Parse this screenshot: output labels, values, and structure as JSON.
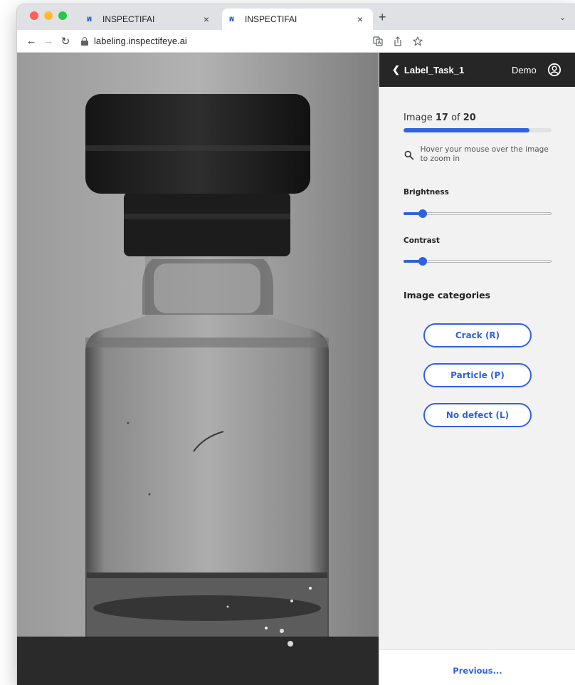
{
  "browser": {
    "tabs": [
      {
        "title": "INSPECTIFAI",
        "favicon": "inspectifai-logo-icon",
        "active": false
      },
      {
        "title": "INSPECTIFAI",
        "favicon": "inspectifai-logo-icon",
        "active": true
      }
    ],
    "tab_close_glyph": "×",
    "new_tab_glyph": "+",
    "url": "labeling.inspectifeye.ai"
  },
  "header": {
    "task_title": "Label_Task_1",
    "user_label": "Demo"
  },
  "progress": {
    "prefix": "Image",
    "current": "17",
    "joiner": "of",
    "total": "20",
    "fraction_complete": 0.85
  },
  "zoom_hint": "Hover your mouse over the image to zoom in",
  "adjustments": {
    "brightness": {
      "label": "Brightness",
      "level": 0.13
    },
    "contrast": {
      "label": "Contrast",
      "level": 0.13
    }
  },
  "categories": {
    "heading": "Image categories",
    "options": [
      "Crack (R)",
      "Particle (P)",
      "No defect (L)"
    ]
  },
  "footer": {
    "previous_label": "Previous..."
  },
  "colors": {
    "accent": "#2f62e0",
    "header_bg": "#262626",
    "sidebar_bg": "#f2f2f2"
  }
}
